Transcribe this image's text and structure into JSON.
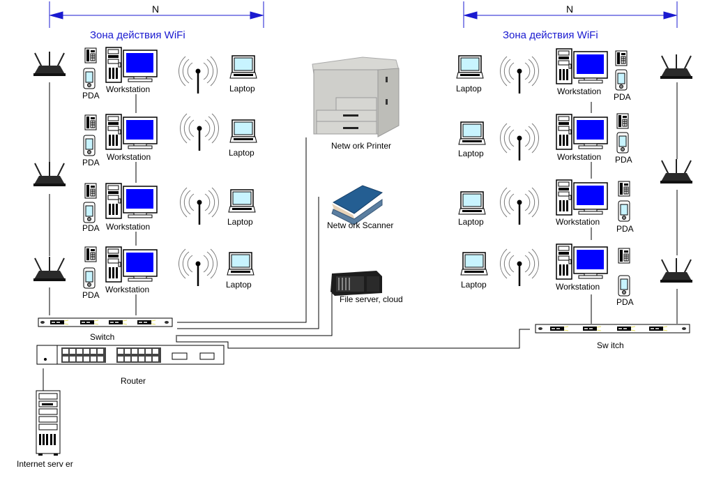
{
  "diagram": {
    "zones": [
      {
        "id": "left",
        "dimension_label": "N",
        "zone_label": "Зона действия WiFi"
      },
      {
        "id": "right",
        "dimension_label": "N",
        "zone_label": "Зона действия WiFi"
      }
    ],
    "left_rows": [
      {
        "pda": "PDA",
        "workstation": "Workstation",
        "laptop": "Laptop"
      },
      {
        "pda": "PDA",
        "workstation": "Workstation",
        "laptop": "Laptop"
      },
      {
        "pda": "PDA",
        "workstation": "Workstation",
        "laptop": "Laptop"
      },
      {
        "pda": "PDA",
        "workstation": "Workstation",
        "laptop": "Laptop"
      }
    ],
    "right_rows": [
      {
        "pda": "PDA",
        "workstation": "Workstation",
        "laptop": "Laptop"
      },
      {
        "pda": "PDA",
        "workstation": "Workstation",
        "laptop": "Laptop"
      },
      {
        "pda": "PDA",
        "workstation": "Workstation",
        "laptop": "Laptop"
      },
      {
        "pda": "PDA",
        "workstation": "Workstation",
        "laptop": "Laptop"
      }
    ],
    "center": {
      "printer": "Netw ork Printer",
      "scanner": "Netw ork Scanner",
      "file_server": "File server, cloud"
    },
    "left_switch": "Switch",
    "right_switch": "Sw itch",
    "router": "Router",
    "internet_server": "Internet serv er",
    "colors": {
      "zone_text": "#1a1ad0",
      "dimension_line": "#1a1ad0",
      "screen": "#0000ff",
      "laptop_screen": "#c8f4ff"
    }
  }
}
